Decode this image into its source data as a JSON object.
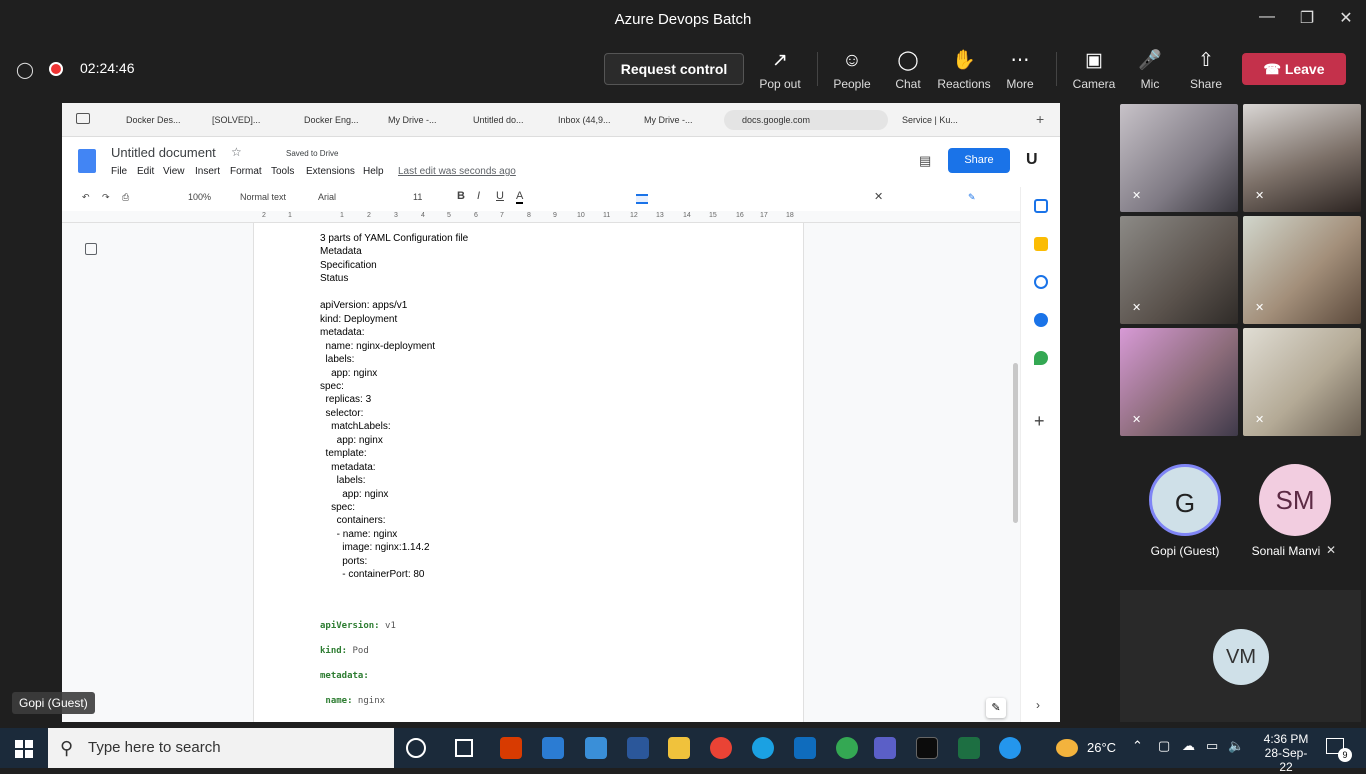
{
  "window": {
    "title": "Azure Devops Batch"
  },
  "meeting": {
    "timer": "02:24:46",
    "request_control": "Request control",
    "buttons": {
      "popout": "Pop out",
      "people": "People",
      "chat": "Chat",
      "reactions": "Reactions",
      "more": "More",
      "camera": "Camera",
      "mic": "Mic",
      "share": "Share"
    },
    "leave": "Leave",
    "presenter_label": "Gopi (Guest)"
  },
  "browser": {
    "tabs": [
      "Docker Des...",
      "[SOLVED]...",
      "Docker Eng...",
      "My Drive -...",
      "Untitled do...",
      "Inbox (44,9...",
      "My Drive -...",
      "docs.google.com",
      "Service | Ku..."
    ]
  },
  "doc": {
    "title": "Untitled document",
    "saved": "Saved to Drive",
    "menus": [
      "File",
      "Edit",
      "View",
      "Insert",
      "Format",
      "Tools",
      "Extensions",
      "Help"
    ],
    "last_edit": "Last edit was seconds ago",
    "share": "Share",
    "toolbar": {
      "zoom": "100%",
      "style": "Normal text",
      "font": "Arial",
      "size": "11"
    },
    "ruler": [
      "2",
      "1",
      "1",
      "2",
      "3",
      "4",
      "5",
      "6",
      "7",
      "8",
      "9",
      "10",
      "11",
      "12",
      "13",
      "14",
      "15",
      "16",
      "17",
      "18"
    ],
    "lines": [
      "3 parts of YAML Configuration file",
      "Metadata",
      "Specification",
      "Status",
      "",
      "apiVersion: apps/v1",
      "kind: Deployment",
      "metadata:",
      "  name: nginx-deployment",
      "  labels:",
      "    app: nginx",
      "spec:",
      "  replicas: 3",
      "  selector:",
      "    matchLabels:",
      "      app: nginx",
      "  template:",
      "    metadata:",
      "      labels:",
      "        app: nginx",
      "    spec:",
      "      containers:",
      "      - name: nginx",
      "        image: nginx:1.14.2",
      "        ports:",
      "        - containerPort: 80"
    ],
    "code_lines": [
      {
        "key": "apiVersion:",
        "val": " v1"
      },
      {
        "key": "kind:",
        "val": " Pod"
      },
      {
        "key": "metadata:",
        "val": ""
      },
      {
        "key": " name:",
        "val": " nginx"
      }
    ]
  },
  "participants": {
    "guest": {
      "initial": "G",
      "name": "Gopi (Guest)"
    },
    "sonali": {
      "initial": "SM",
      "name": "Sonali Manvi"
    },
    "vm": {
      "initial": "VM"
    }
  },
  "taskbar": {
    "search_placeholder": "Type here to search",
    "weather": "26°C",
    "time": "4:36 PM",
    "date": "28-Sep-22",
    "notifications": "9"
  }
}
